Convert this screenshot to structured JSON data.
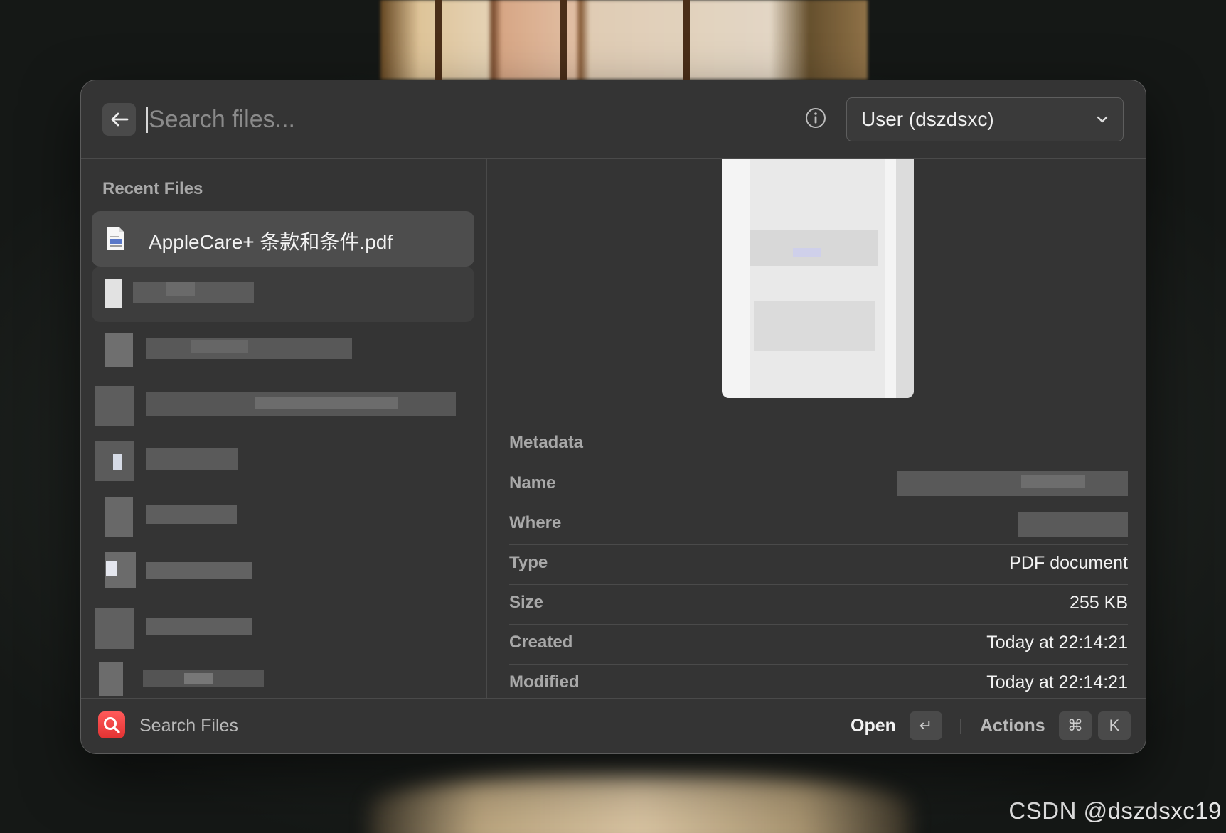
{
  "search": {
    "placeholder": "Search files...",
    "value": ""
  },
  "scope": {
    "selected": "User (dszdsxc)"
  },
  "recent": {
    "title": "Recent Files",
    "selected_item": {
      "label": "AppleCare+ 条款和条件.pdf",
      "icon": "pdf-file-icon"
    }
  },
  "metadata": {
    "title": "Metadata",
    "rows": [
      {
        "key": "Name",
        "value": ""
      },
      {
        "key": "Where",
        "value": ""
      },
      {
        "key": "Type",
        "value": "PDF document"
      },
      {
        "key": "Size",
        "value": "255 KB"
      },
      {
        "key": "Created",
        "value": "Today at 22:14:21"
      },
      {
        "key": "Modified",
        "value": "Today at 22:14:21"
      }
    ]
  },
  "footer": {
    "app_name": "Search Files",
    "open_label": "Open",
    "open_key": "↵",
    "actions_label": "Actions",
    "actions_keys": [
      "⌘",
      "K"
    ]
  },
  "watermark": "CSDN @dszdsxc19",
  "icons": [
    "back-arrow-icon",
    "info-icon",
    "chevron-down-icon",
    "pdf-file-icon",
    "search-icon",
    "return-key-icon"
  ],
  "colors": {
    "panel": "#343434",
    "selected_row": "#4d4d4d",
    "app_icon": "#e23232"
  }
}
